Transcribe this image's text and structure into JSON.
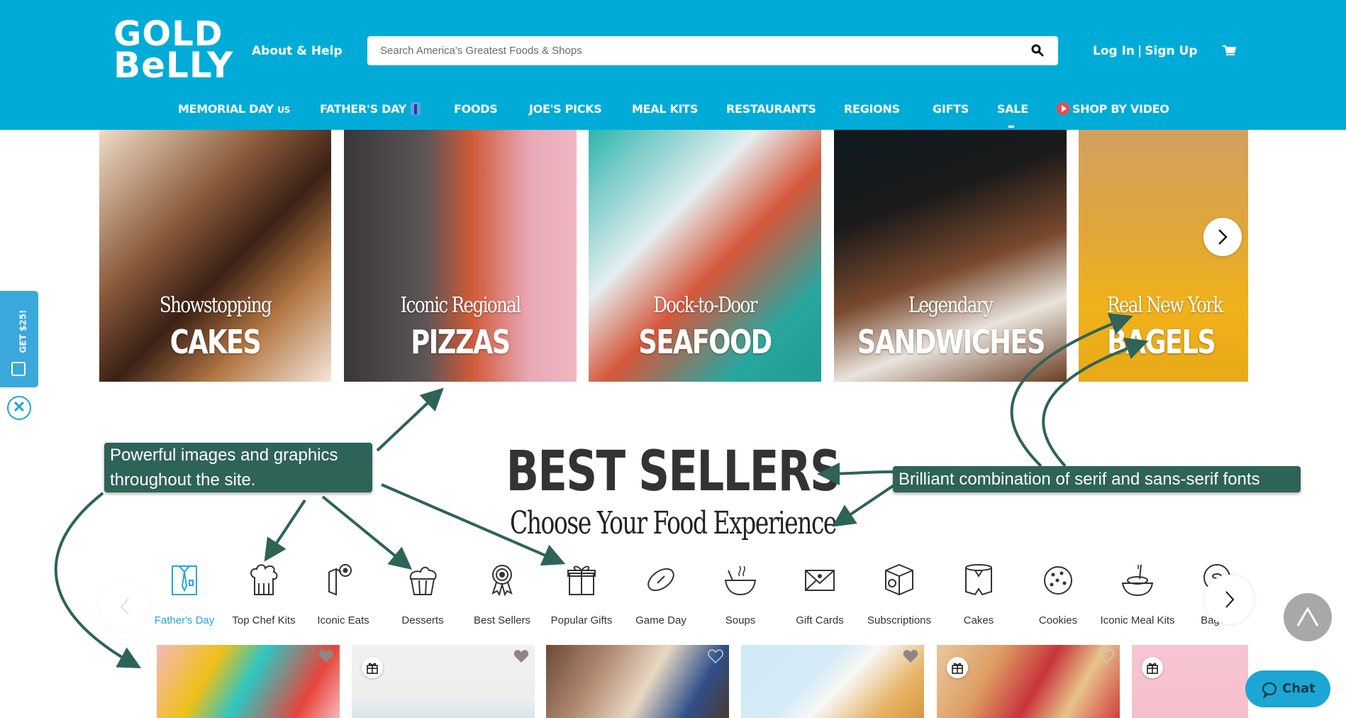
{
  "header": {
    "logo_line1": "GOLD",
    "logo_line2": "BeLLY",
    "about_help": "About & Help",
    "search_placeholder": "Search America's Greatest Foods & Shops",
    "login": "Log In",
    "separator": "|",
    "signup": "Sign Up",
    "cart_icon": "cart-icon",
    "brand_color": "#00acd7"
  },
  "nav": {
    "items": [
      {
        "label": "MEMORIAL DAY",
        "suffix": "US"
      },
      {
        "label": "FATHER'S DAY",
        "icon": "shirt-tie-icon"
      },
      {
        "label": "FOODS"
      },
      {
        "label": "JOE'S PICKS"
      },
      {
        "label": "MEAL KITS"
      },
      {
        "label": "RESTAURANTS"
      },
      {
        "label": "REGIONS"
      },
      {
        "label": "GIFTS"
      },
      {
        "label": "SALE"
      },
      {
        "label": "SHOP BY VIDEO",
        "icon": "play-icon"
      }
    ]
  },
  "hero": {
    "tiles": [
      {
        "line1": "Showstopping",
        "line2": "CAKES"
      },
      {
        "line1": "Iconic Regional",
        "line2": "PIZZAS"
      },
      {
        "line1": "Dock-to-Door",
        "line2": "SEAFOOD"
      },
      {
        "line1": "Legendary",
        "line2": "SANDWICHES"
      },
      {
        "line1": "Real New York",
        "line2": "BAGELS"
      }
    ]
  },
  "promo": {
    "label": "GET $25!",
    "close": "✕"
  },
  "annotations": {
    "images": "Powerful images and graphics throughout the site.",
    "fonts": "Brilliant combination of serif and sans-serif fonts",
    "color": "#2e6358"
  },
  "best_sellers": {
    "title": "BEST SELLERS",
    "subtitle": "Choose Your Food Experience"
  },
  "categories": [
    {
      "label": "Father's Day",
      "active": true
    },
    {
      "label": "Top Chef Kits"
    },
    {
      "label": "Iconic Eats"
    },
    {
      "label": "Desserts"
    },
    {
      "label": "Best Sellers"
    },
    {
      "label": "Popular Gifts"
    },
    {
      "label": "Game Day"
    },
    {
      "label": "Soups"
    },
    {
      "label": "Gift Cards"
    },
    {
      "label": "Subscriptions"
    },
    {
      "label": "Cakes"
    },
    {
      "label": "Cookies"
    },
    {
      "label": "Iconic Meal Kits"
    },
    {
      "label": "Bagels"
    }
  ],
  "chat": {
    "label": "Chat"
  }
}
